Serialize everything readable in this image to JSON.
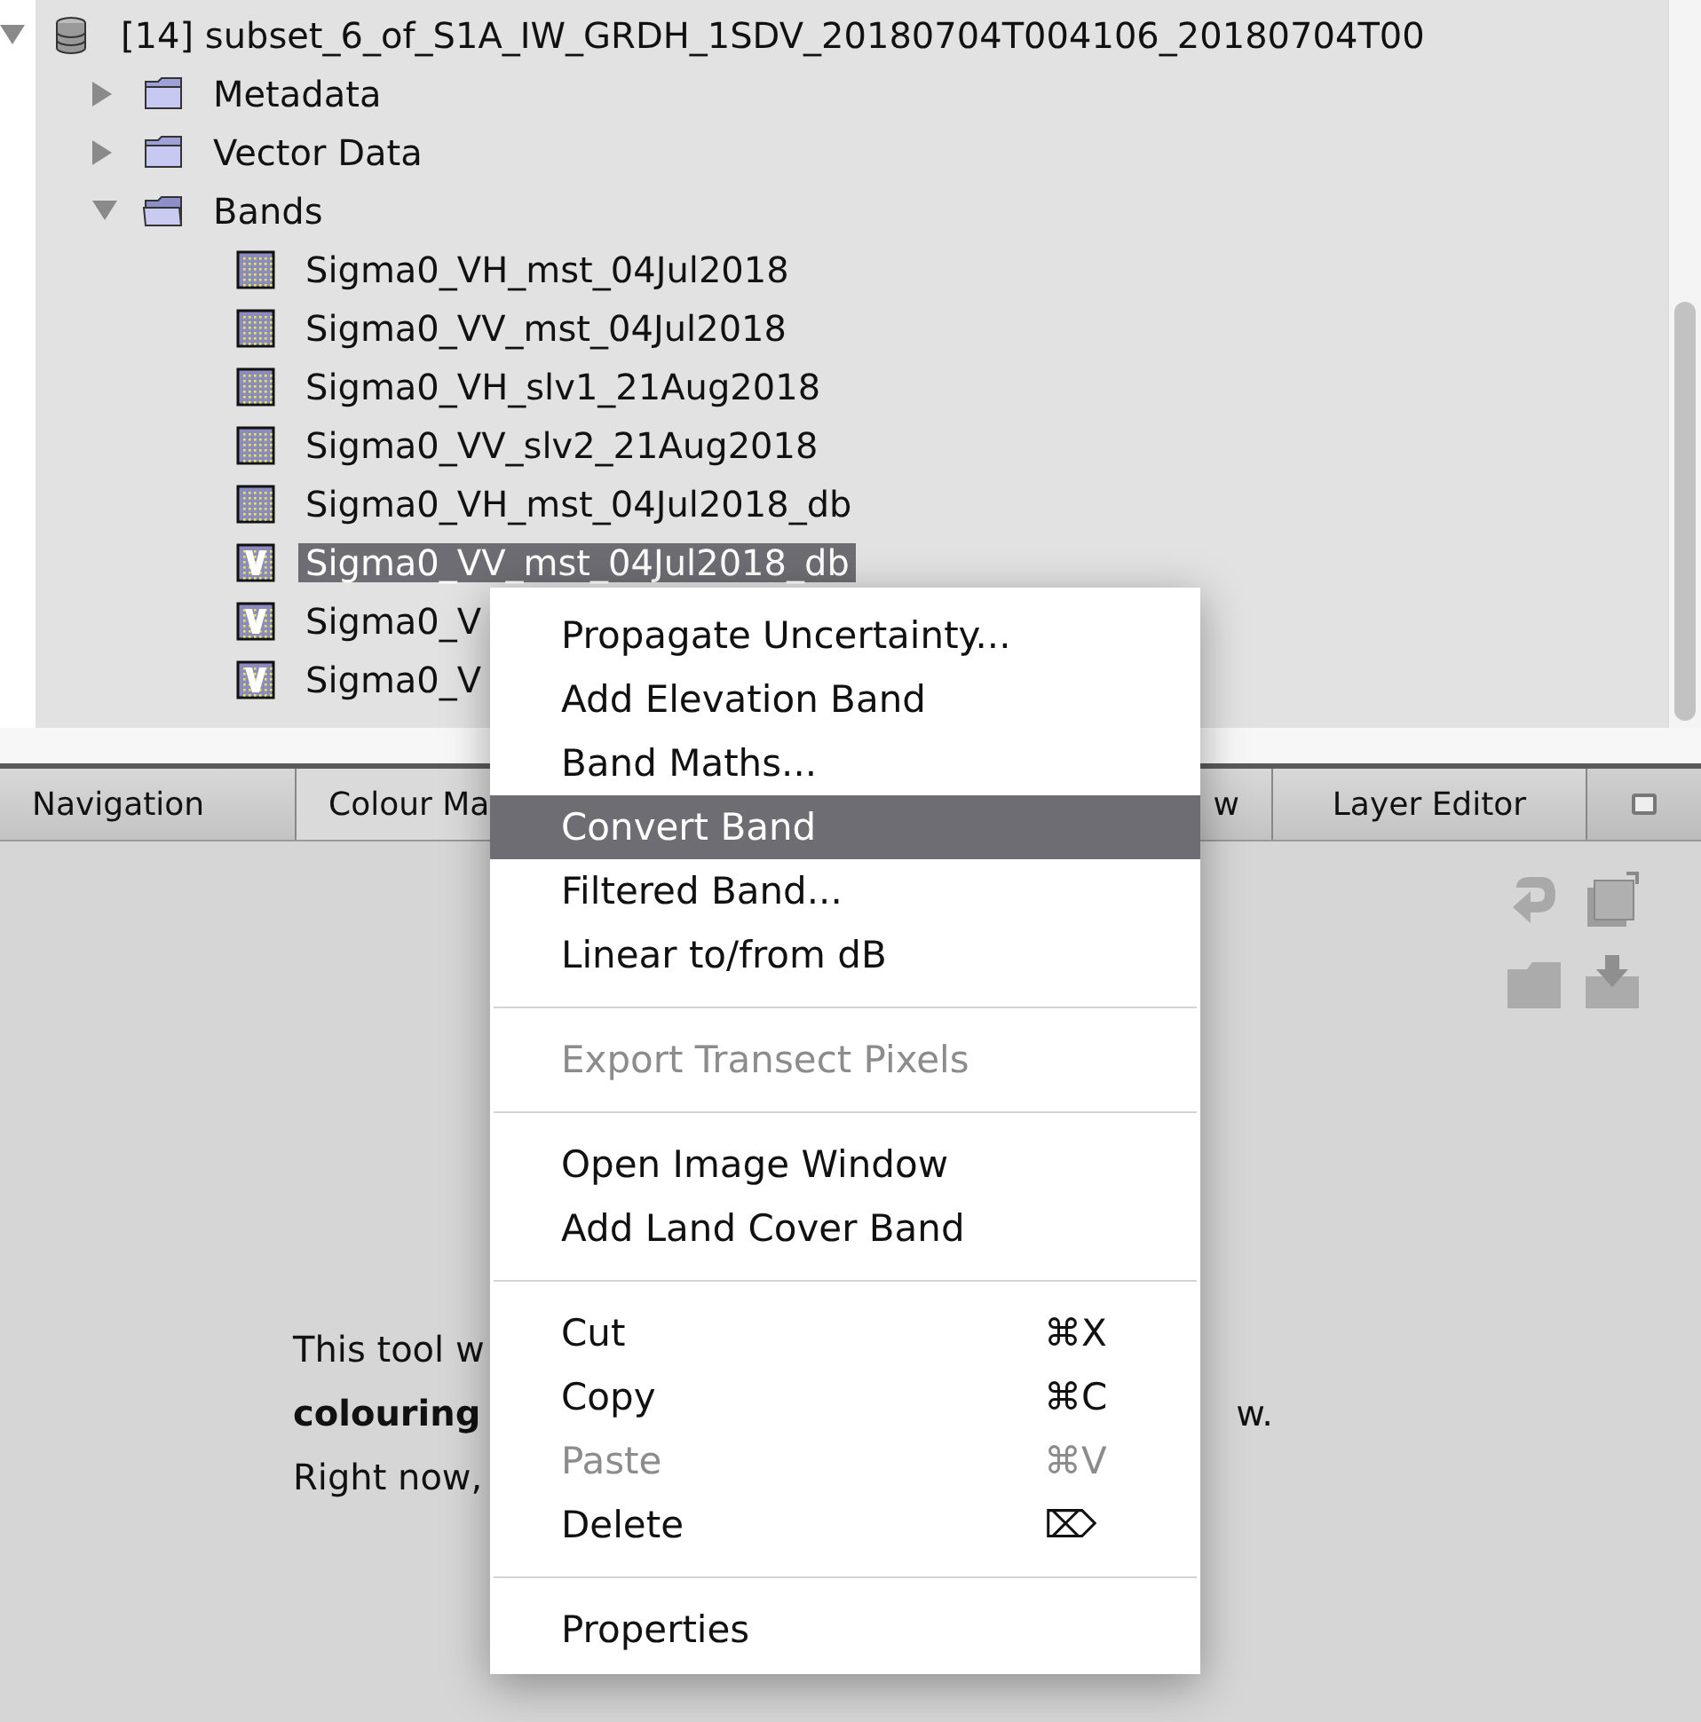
{
  "tree": {
    "nodes": [
      {
        "label": "[14] subset_6_of_S1A_IW_GRDH_1SDV_20180704T004106_20180704T00",
        "kind": "product",
        "expanded": true,
        "selected": false,
        "children": [
          {
            "label": "Metadata",
            "kind": "folder",
            "expanded": false,
            "selected": false
          },
          {
            "label": "Vector Data",
            "kind": "folder",
            "expanded": false,
            "selected": false
          },
          {
            "label": "Bands",
            "kind": "folder",
            "expanded": true,
            "selected": false,
            "children": [
              {
                "label": "Sigma0_VH_mst_04Jul2018",
                "kind": "band",
                "selected": false
              },
              {
                "label": "Sigma0_VV_mst_04Jul2018",
                "kind": "band",
                "selected": false
              },
              {
                "label": "Sigma0_VH_slv1_21Aug2018",
                "kind": "band",
                "selected": false
              },
              {
                "label": "Sigma0_VV_slv2_21Aug2018",
                "kind": "band",
                "selected": false
              },
              {
                "label": "Sigma0_VH_mst_04Jul2018_db",
                "kind": "band",
                "selected": false
              },
              {
                "label": "Sigma0_VV_mst_04Jul2018_db",
                "kind": "virtual-band",
                "selected": true
              },
              {
                "label": "Sigma0_V",
                "kind": "virtual-band",
                "selected": false
              },
              {
                "label": "Sigma0_V",
                "kind": "virtual-band",
                "selected": false
              }
            ]
          }
        ]
      }
    ]
  },
  "tabs": [
    {
      "label": "Navigation",
      "selected": false
    },
    {
      "label": "Colour Ma",
      "selected": true
    },
    {
      "label": "w",
      "selected": false
    },
    {
      "label": "Layer Editor",
      "selected": false
    }
  ],
  "info_lines": [
    {
      "text": "This tool w"
    },
    {
      "text": "**colouring**",
      "tail": "w."
    },
    {
      "text": "Right now,"
    }
  ],
  "context_menu": [
    {
      "kind": "item",
      "label": "Propagate Uncertainty...",
      "disabled": false,
      "selected": false
    },
    {
      "kind": "item",
      "label": "Add Elevation Band",
      "disabled": false,
      "selected": false
    },
    {
      "kind": "item",
      "label": "Band Maths...",
      "disabled": false,
      "selected": false
    },
    {
      "kind": "item",
      "label": "Convert Band",
      "disabled": false,
      "selected": true
    },
    {
      "kind": "item",
      "label": "Filtered Band...",
      "disabled": false,
      "selected": false
    },
    {
      "kind": "item",
      "label": "Linear to/from dB",
      "disabled": false,
      "selected": false
    },
    {
      "kind": "separator"
    },
    {
      "kind": "item",
      "label": "Export Transect Pixels",
      "disabled": true,
      "selected": false
    },
    {
      "kind": "separator"
    },
    {
      "kind": "item",
      "label": "Open Image Window",
      "disabled": false,
      "selected": false
    },
    {
      "kind": "item",
      "label": "Add Land Cover Band",
      "disabled": false,
      "selected": false
    },
    {
      "kind": "separator"
    },
    {
      "kind": "item",
      "label": "Cut",
      "shortcut": "⌘X",
      "disabled": false,
      "selected": false
    },
    {
      "kind": "item",
      "label": "Copy",
      "shortcut": "⌘C",
      "disabled": false,
      "selected": false
    },
    {
      "kind": "item",
      "label": "Paste",
      "shortcut": "⌘V",
      "disabled": true,
      "selected": false
    },
    {
      "kind": "item",
      "label": "Delete",
      "shortcut": "⌦",
      "disabled": false,
      "selected": false
    },
    {
      "kind": "separator"
    },
    {
      "kind": "item",
      "label": "Properties",
      "disabled": false,
      "selected": false
    }
  ]
}
